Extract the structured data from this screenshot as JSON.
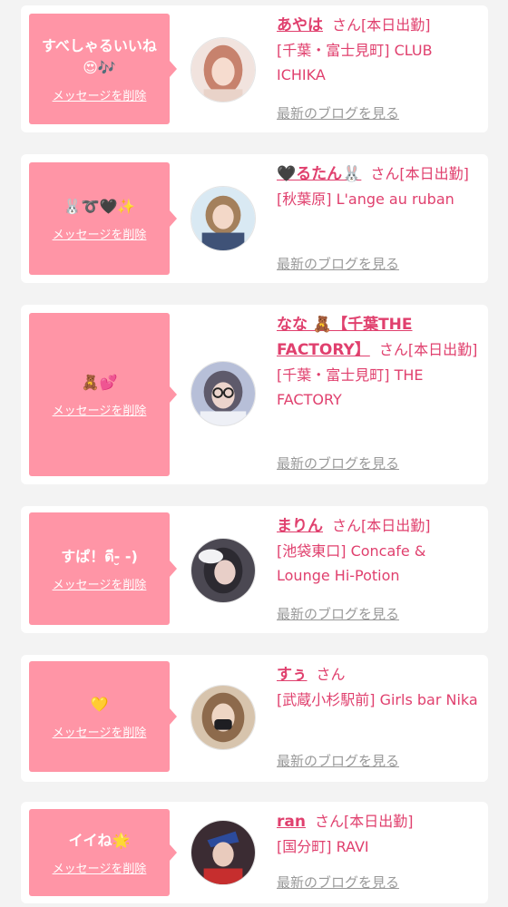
{
  "common": {
    "delete_label": "メッセージを削除",
    "blog_label": "最新のブログを見る",
    "san": "さん"
  },
  "cards": [
    {
      "message": "すべしゃるいいね😍🎶",
      "name": "あやは",
      "status": "[本日出勤]",
      "shop": "[千葉・富士見町] CLUB ICHIKA"
    },
    {
      "message": "🐰➰🖤✨",
      "name": "🖤るたん🐰",
      "status": "[本日出勤]",
      "shop": "[秋葉原] L'ange au ruban"
    },
    {
      "message": "🧸💕",
      "name": "なな 🧸【千葉THE FACTORY】",
      "status": "[本日出勤]",
      "shop": "[千葉・富士見町] THE FACTORY"
    },
    {
      "message": "すぱ！ดี-̮ -)",
      "name": "まりん",
      "status": "[本日出勤]",
      "shop": "[池袋東口] Concafe & Lounge Hi-Potion"
    },
    {
      "message": "💛",
      "name": "すぅ",
      "status": "",
      "shop": "[武蔵小杉駅前] Girls bar Nika"
    },
    {
      "message": "イイね🌟",
      "name": "ran",
      "status": "[本日出勤]",
      "shop": "[国分町] RAVI"
    }
  ],
  "colors": {
    "accent": "#e0406e",
    "bubble": "#ff95a6"
  }
}
